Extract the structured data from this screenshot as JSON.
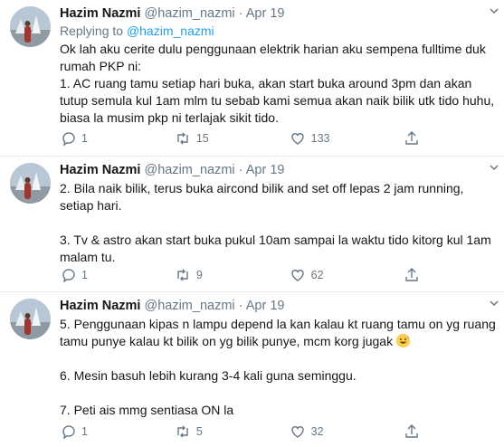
{
  "tweets": [
    {
      "name": "Hazim Nazmi",
      "handle": "@hazim_nazmi",
      "separator": "·",
      "date": "Apr 19",
      "replying_prefix": "Replying to ",
      "replying_to": "@hazim_nazmi",
      "text": "Ok lah aku cerite dulu penggunaan elektrik harian aku sempena fulltime duk rumah PKP ni:\n1. AC ruang tamu setiap hari buka, akan start buka around 3pm dan akan tutup semula kul 1am mlm tu sebab kami semua akan naik bilik utk tido huhu, biasa la musim pkp ni terlajak sikit tido.",
      "replies": "1",
      "retweets": "15",
      "likes": "133"
    },
    {
      "name": "Hazim Nazmi",
      "handle": "@hazim_nazmi",
      "separator": "·",
      "date": "Apr 19",
      "text": "2. Bila naik bilik, terus buka aircond bilik and set off lepas 2 jam running, setiap hari.\n\n3. Tv & astro akan start buka pukul 10am sampai la waktu tido kitorg kul 1am malam tu.",
      "replies": "1",
      "retweets": "9",
      "likes": "62"
    },
    {
      "name": "Hazim Nazmi",
      "handle": "@hazim_nazmi",
      "separator": "·",
      "date": "Apr 19",
      "text": "5. Penggunaan kipas n lampu depend la kan kalau kt ruang tamu on yg ruang tamu punye kalau kt bilik on yg bilik punye, mcm korg jugak",
      "text2": "6. Mesin basuh lebih kurang 3-4 kali guna seminggu.\n\n7. Peti ais mmg sentiasa ON la",
      "replies": "1",
      "retweets": "5",
      "likes": "32"
    }
  ],
  "icons": {
    "reply": "reply-icon",
    "retweet": "retweet-icon",
    "like": "heart-icon",
    "share": "share-icon",
    "more": "chevron-down-icon",
    "emoji": "grinning-sweat-emoji"
  },
  "colors": {
    "text": "#14171a",
    "muted": "#657786",
    "link": "#1da1f2",
    "divider": "#e6ecf0"
  }
}
